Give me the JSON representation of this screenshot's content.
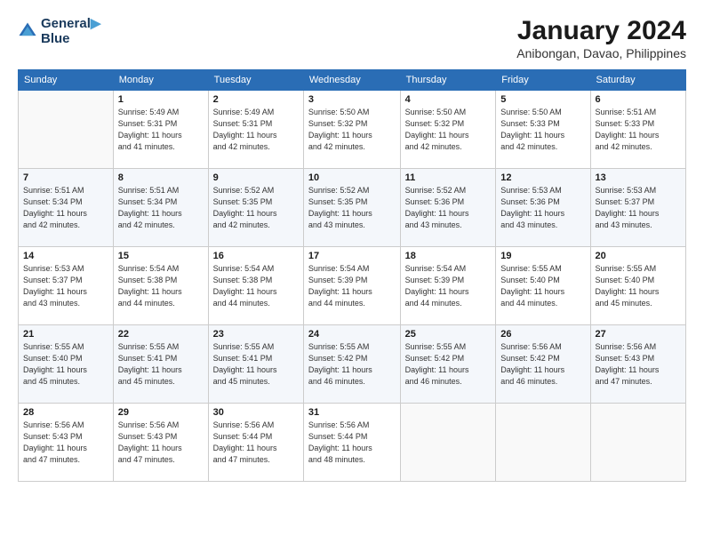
{
  "header": {
    "logo_line1": "General",
    "logo_line2": "Blue",
    "month_title": "January 2024",
    "location": "Anibongan, Davao, Philippines"
  },
  "weekdays": [
    "Sunday",
    "Monday",
    "Tuesday",
    "Wednesday",
    "Thursday",
    "Friday",
    "Saturday"
  ],
  "weeks": [
    [
      {
        "day": "",
        "info": ""
      },
      {
        "day": "1",
        "info": "Sunrise: 5:49 AM\nSunset: 5:31 PM\nDaylight: 11 hours\nand 41 minutes."
      },
      {
        "day": "2",
        "info": "Sunrise: 5:49 AM\nSunset: 5:31 PM\nDaylight: 11 hours\nand 42 minutes."
      },
      {
        "day": "3",
        "info": "Sunrise: 5:50 AM\nSunset: 5:32 PM\nDaylight: 11 hours\nand 42 minutes."
      },
      {
        "day": "4",
        "info": "Sunrise: 5:50 AM\nSunset: 5:32 PM\nDaylight: 11 hours\nand 42 minutes."
      },
      {
        "day": "5",
        "info": "Sunrise: 5:50 AM\nSunset: 5:33 PM\nDaylight: 11 hours\nand 42 minutes."
      },
      {
        "day": "6",
        "info": "Sunrise: 5:51 AM\nSunset: 5:33 PM\nDaylight: 11 hours\nand 42 minutes."
      }
    ],
    [
      {
        "day": "7",
        "info": "Sunrise: 5:51 AM\nSunset: 5:34 PM\nDaylight: 11 hours\nand 42 minutes."
      },
      {
        "day": "8",
        "info": "Sunrise: 5:51 AM\nSunset: 5:34 PM\nDaylight: 11 hours\nand 42 minutes."
      },
      {
        "day": "9",
        "info": "Sunrise: 5:52 AM\nSunset: 5:35 PM\nDaylight: 11 hours\nand 42 minutes."
      },
      {
        "day": "10",
        "info": "Sunrise: 5:52 AM\nSunset: 5:35 PM\nDaylight: 11 hours\nand 43 minutes."
      },
      {
        "day": "11",
        "info": "Sunrise: 5:52 AM\nSunset: 5:36 PM\nDaylight: 11 hours\nand 43 minutes."
      },
      {
        "day": "12",
        "info": "Sunrise: 5:53 AM\nSunset: 5:36 PM\nDaylight: 11 hours\nand 43 minutes."
      },
      {
        "day": "13",
        "info": "Sunrise: 5:53 AM\nSunset: 5:37 PM\nDaylight: 11 hours\nand 43 minutes."
      }
    ],
    [
      {
        "day": "14",
        "info": "Sunrise: 5:53 AM\nSunset: 5:37 PM\nDaylight: 11 hours\nand 43 minutes."
      },
      {
        "day": "15",
        "info": "Sunrise: 5:54 AM\nSunset: 5:38 PM\nDaylight: 11 hours\nand 44 minutes."
      },
      {
        "day": "16",
        "info": "Sunrise: 5:54 AM\nSunset: 5:38 PM\nDaylight: 11 hours\nand 44 minutes."
      },
      {
        "day": "17",
        "info": "Sunrise: 5:54 AM\nSunset: 5:39 PM\nDaylight: 11 hours\nand 44 minutes."
      },
      {
        "day": "18",
        "info": "Sunrise: 5:54 AM\nSunset: 5:39 PM\nDaylight: 11 hours\nand 44 minutes."
      },
      {
        "day": "19",
        "info": "Sunrise: 5:55 AM\nSunset: 5:40 PM\nDaylight: 11 hours\nand 44 minutes."
      },
      {
        "day": "20",
        "info": "Sunrise: 5:55 AM\nSunset: 5:40 PM\nDaylight: 11 hours\nand 45 minutes."
      }
    ],
    [
      {
        "day": "21",
        "info": "Sunrise: 5:55 AM\nSunset: 5:40 PM\nDaylight: 11 hours\nand 45 minutes."
      },
      {
        "day": "22",
        "info": "Sunrise: 5:55 AM\nSunset: 5:41 PM\nDaylight: 11 hours\nand 45 minutes."
      },
      {
        "day": "23",
        "info": "Sunrise: 5:55 AM\nSunset: 5:41 PM\nDaylight: 11 hours\nand 45 minutes."
      },
      {
        "day": "24",
        "info": "Sunrise: 5:55 AM\nSunset: 5:42 PM\nDaylight: 11 hours\nand 46 minutes."
      },
      {
        "day": "25",
        "info": "Sunrise: 5:55 AM\nSunset: 5:42 PM\nDaylight: 11 hours\nand 46 minutes."
      },
      {
        "day": "26",
        "info": "Sunrise: 5:56 AM\nSunset: 5:42 PM\nDaylight: 11 hours\nand 46 minutes."
      },
      {
        "day": "27",
        "info": "Sunrise: 5:56 AM\nSunset: 5:43 PM\nDaylight: 11 hours\nand 47 minutes."
      }
    ],
    [
      {
        "day": "28",
        "info": "Sunrise: 5:56 AM\nSunset: 5:43 PM\nDaylight: 11 hours\nand 47 minutes."
      },
      {
        "day": "29",
        "info": "Sunrise: 5:56 AM\nSunset: 5:43 PM\nDaylight: 11 hours\nand 47 minutes."
      },
      {
        "day": "30",
        "info": "Sunrise: 5:56 AM\nSunset: 5:44 PM\nDaylight: 11 hours\nand 47 minutes."
      },
      {
        "day": "31",
        "info": "Sunrise: 5:56 AM\nSunset: 5:44 PM\nDaylight: 11 hours\nand 48 minutes."
      },
      {
        "day": "",
        "info": ""
      },
      {
        "day": "",
        "info": ""
      },
      {
        "day": "",
        "info": ""
      }
    ]
  ]
}
